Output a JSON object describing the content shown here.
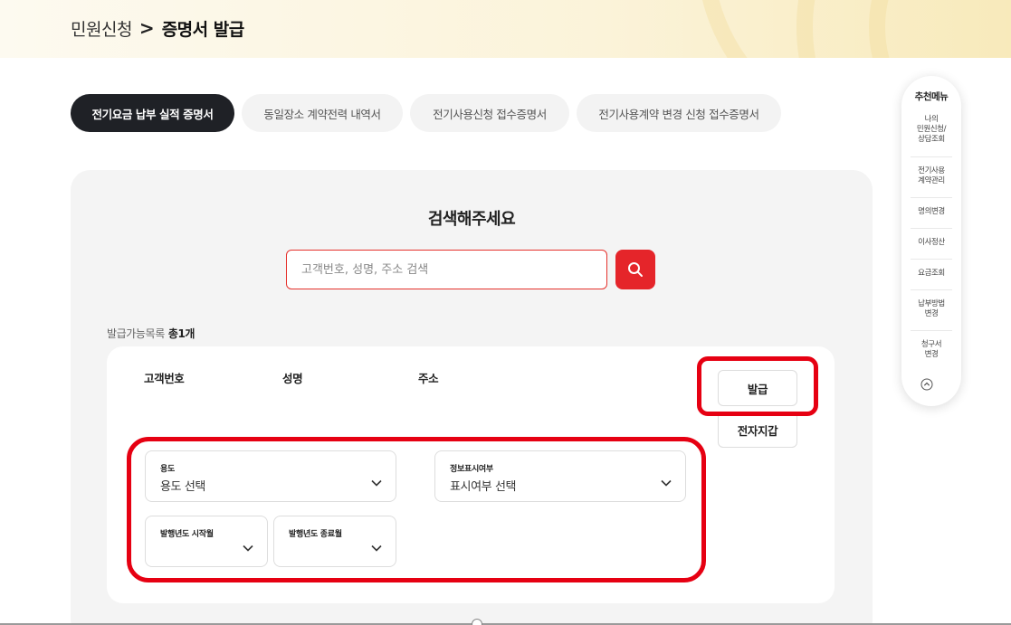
{
  "breadcrumb": {
    "parent": "민원신청",
    "separator": ">",
    "current": "증명서 발급"
  },
  "tabs": [
    {
      "label": "전기요금 납부 실적 증명서",
      "active": true
    },
    {
      "label": "동일장소 계약전력 내역서",
      "active": false
    },
    {
      "label": "전기사용신청 접수증명서",
      "active": false
    },
    {
      "label": "전기사용계약 변경 신청 접수증명서",
      "active": false
    }
  ],
  "search": {
    "title": "검색해주세요",
    "placeholder": "고객번호, 성명, 주소 검색",
    "value": "",
    "button_icon": "search-icon"
  },
  "list": {
    "label": "발급가능목록",
    "count": "총1개"
  },
  "table": {
    "headers": {
      "customer_no": "고객번호",
      "name": "성명",
      "address": "주소"
    },
    "issue_button": "발급",
    "wallet_button": "전자지갑"
  },
  "fields": {
    "usage": {
      "label": "용도",
      "value": "용도 선택"
    },
    "info_display": {
      "label": "정보표시여부",
      "value": "표시여부 선택"
    },
    "start_month": {
      "label": "발행년도 시작월",
      "value": ""
    },
    "end_month": {
      "label": "발행년도 종료월",
      "value": ""
    }
  },
  "quick_menu": {
    "title": "추천메뉴",
    "items": [
      "나의\n민원신청/\n상담조회",
      "전기사용\n계약관리",
      "명의변경",
      "이사정산",
      "요금조회",
      "납부방법\n변경",
      "청구서\n변경"
    ],
    "top_icon": "chevron-up-circle-icon"
  },
  "colors": {
    "accent_red": "#e5252a",
    "highlight_red": "#e60012",
    "tab_active_bg": "#1f2126",
    "panel_bg": "#f4f4f4"
  }
}
